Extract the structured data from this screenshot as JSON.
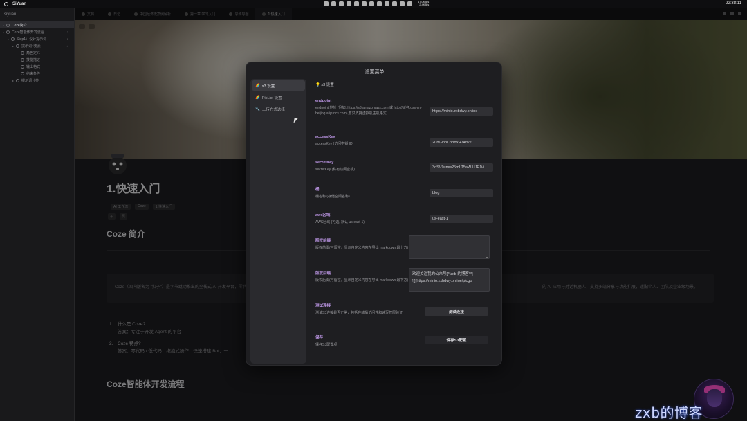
{
  "menubar": {
    "app_name": "SiYuan",
    "net_up": "47.0KB/s",
    "net_down": "2.4KB/s",
    "clock": "22:38:11"
  },
  "sidebar": {
    "workspace": "siyuan",
    "items": [
      {
        "label": "Coze简介",
        "level": 0,
        "active": true,
        "count": ""
      },
      {
        "label": "Coze智能体开发流程",
        "level": 0,
        "active": false,
        "count": "3"
      },
      {
        "label": "Step1：设计提示词",
        "level": 1,
        "active": false,
        "count": "1"
      },
      {
        "label": "提示词4要素",
        "level": 2,
        "active": false,
        "count": "4"
      },
      {
        "label": "角色定义",
        "level": 3,
        "active": false,
        "count": ""
      },
      {
        "label": "技能描述",
        "level": 3,
        "active": false,
        "count": ""
      },
      {
        "label": "输出格式",
        "level": 3,
        "active": false,
        "count": ""
      },
      {
        "label": "约束条件",
        "level": 3,
        "active": false,
        "count": ""
      },
      {
        "label": "提示词分类",
        "level": 2,
        "active": false,
        "count": ""
      }
    ]
  },
  "tabs": [
    {
      "label": "文档"
    },
    {
      "label": "日记"
    },
    {
      "label": "中国经济史案例解析"
    },
    {
      "label": "第一章 学习入门"
    },
    {
      "label": "思维导图"
    },
    {
      "label": "1.快速入门",
      "active": true
    }
  ],
  "document": {
    "title": "1.快速入门",
    "breadcrumbs": [
      "AI 工作流",
      "Coze",
      "1.快速入门"
    ],
    "meta": [
      "子",
      "页"
    ],
    "heading1": "Coze 简介",
    "callout_left": "Coze（国内版名为 \"扣子\"）是字节跳动推出的全栈式 AI 开发平台，零代码门槛，面向所有人开放，",
    "callout_right": "的 AI 应用与对话机器人，支持多端分享与功能扩展，适配个人、团队及企业级场景。",
    "list": [
      {
        "num": "1.",
        "q": "什么是 Coze?",
        "a": "答案：专注于开发 Agent 的平台"
      },
      {
        "num": "2.",
        "q": "Coze 特点?",
        "a": "答案：零代码 / 低代码、拖拽式操作、快速搭建 Bot、一"
      }
    ],
    "heading2": "Coze智能体开发流程"
  },
  "modal": {
    "title": "设置菜单",
    "nav": [
      {
        "icon": "🌈",
        "label": "s3 设置",
        "active": true
      },
      {
        "icon": "🌈",
        "label": "PicList 设置",
        "active": false
      },
      {
        "icon": "🔧",
        "label": "上传方式选择",
        "active": false
      }
    ],
    "intro": "💡 s3 设置",
    "fields": {
      "endpoint": {
        "label": "endpoint",
        "desc": "endpoint 地址 (例如: https://s3.amazonaws.com 或 http://域名.oss-cn-beijing.aliyuncs.com),暂只支持虚拟机主机格式",
        "value": "https://minio.zxbdwy.online"
      },
      "accessKey": {
        "label": "accessKey",
        "desc": "accessKey (访问密钥 ID)",
        "value": "2Ir8GinbC3hYxH74dv2L"
      },
      "secretKey": {
        "label": "secretKey",
        "desc": "secretKey (私有访问密钥)",
        "value": "3oSV9umw25mLT5aWJJJFJVi"
      },
      "bucket": {
        "label": "桶",
        "desc": "桶名称 (存储空间名称)",
        "value": "blog"
      },
      "region": {
        "label": "aws区域",
        "desc": "AWS区域 (可选, 默认 us-east-1)",
        "value": "us-east-1"
      },
      "prefix": {
        "label": "版权前缀",
        "desc": "版权前缀(可留空，显示自定义内容在导出 markdown 最上方)",
        "value": ""
      },
      "suffix": {
        "label": "版权后缀",
        "desc": "版权后缀(可留空，显示自定义内容在导出 markdown 最下方)",
        "line1": "欢迎关注我的公众号[**zxb 的博客**]",
        "line2": "![](https://minio.zxbdwy.online/picgo"
      },
      "test": {
        "label": "测试连接",
        "desc": "测试S3连接是否正常，包括存储桶访问性和读写权限验证",
        "button": "测试连接"
      },
      "save": {
        "label": "保存",
        "desc": "保存S3配置项",
        "button": "保存S3配置"
      }
    }
  },
  "watermark": {
    "text": "zxb的博客"
  },
  "colors": {
    "accent_label": "#bf98e8",
    "modal_bg": "#1e1e21",
    "nav_bg": "#2a2a2e"
  }
}
